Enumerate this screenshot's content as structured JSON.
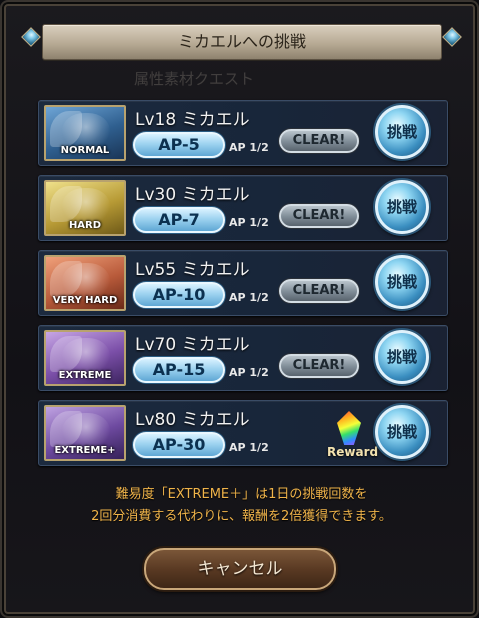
{
  "dialog": {
    "title": "ミカエルへの挑戦",
    "background_ghost_text": "属性素材クエスト"
  },
  "quests": [
    {
      "level_name": "Lv18 ミカエル",
      "difficulty": "NORMAL",
      "ap": "AP-5",
      "ap_half": "AP 1/2",
      "status": "CLEAR!",
      "challenge": "挑戦",
      "thumb_color": "#3d6fa0"
    },
    {
      "level_name": "Lv30 ミカエル",
      "difficulty": "HARD",
      "ap": "AP-7",
      "ap_half": "AP 1/2",
      "status": "CLEAR!",
      "challenge": "挑戦",
      "thumb_color": "#b8a03a"
    },
    {
      "level_name": "Lv55 ミカエル",
      "difficulty": "VERY HARD",
      "ap": "AP-10",
      "ap_half": "AP 1/2",
      "status": "CLEAR!",
      "challenge": "挑戦",
      "thumb_color": "#b0503a"
    },
    {
      "level_name": "Lv70 ミカエル",
      "difficulty": "EXTREME",
      "ap": "AP-15",
      "ap_half": "AP 1/2",
      "status": "CLEAR!",
      "challenge": "挑戦",
      "thumb_color": "#7a4aa0"
    },
    {
      "level_name": "Lv80 ミカエル",
      "difficulty": "EXTREME+",
      "ap": "AP-30",
      "ap_half": "AP 1/2",
      "reward": "Reward",
      "challenge": "挑戦",
      "thumb_color": "#6a4a96"
    }
  ],
  "note": {
    "line1": "難易度「EXTREME＋」は1日の挑戦回数を",
    "line2": "2回分消費する代わりに、報酬を2倍獲得できます。"
  },
  "cancel_label": "キャンセル",
  "colors": {
    "note": "#f0b44a",
    "row_bg": "#1c2a3e",
    "accent_gold": "#b8a26e"
  }
}
